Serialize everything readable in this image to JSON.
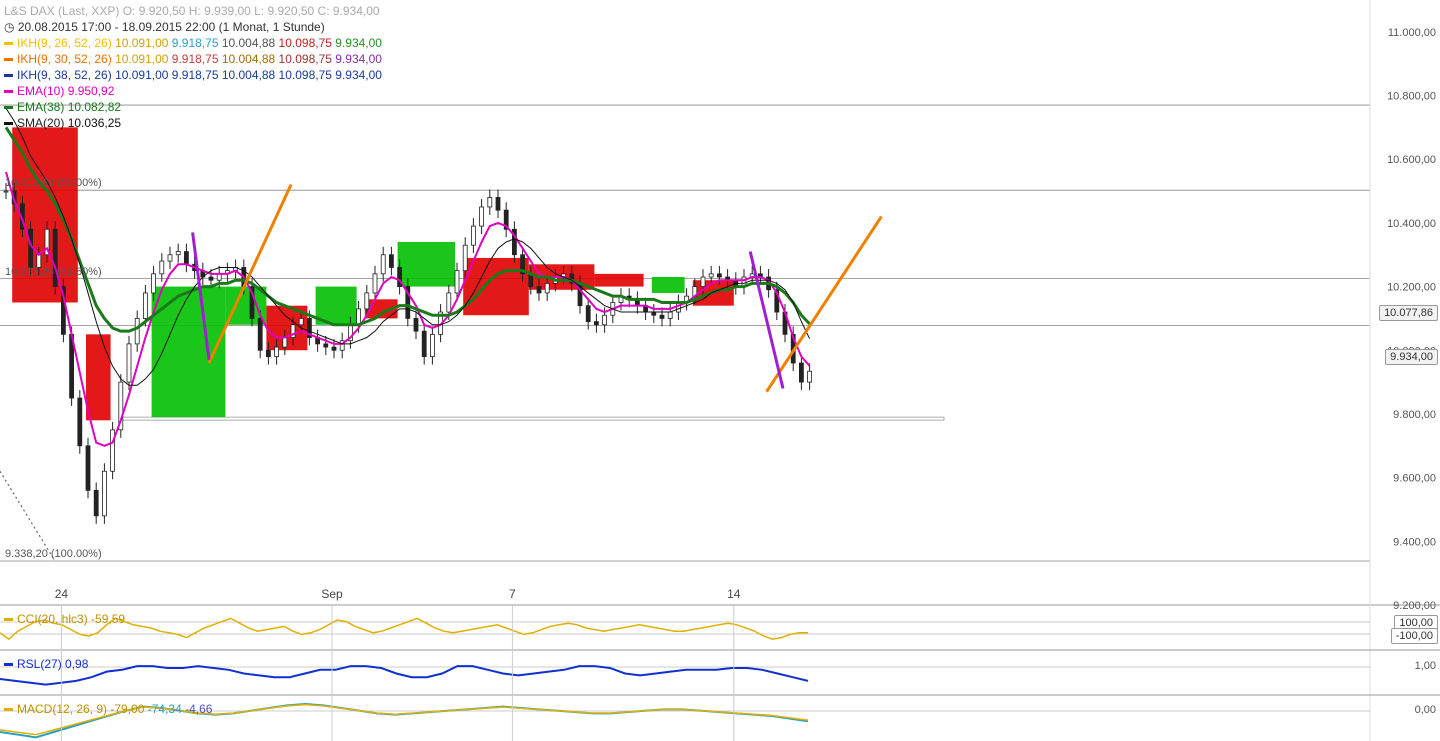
{
  "header": {
    "symbol_line": "L&S DAX (Last, XXP)  O: 9.920,50  H: 9.939,00  L: 9.920,50  C: 9.934,00",
    "range_line": "20.08.2015 17:00 - 18.09.2015 22:00 (1 Monat, 1 Stunde)"
  },
  "legend": [
    {
      "name": "IKH(9, 26, 52, 26)",
      "color": "#f0c000",
      "values": [
        {
          "v": "10.091,00",
          "c": "#d4a000"
        },
        {
          "v": "9.918,75",
          "c": "#2aa0c0"
        },
        {
          "v": "10.004,88",
          "c": "#555"
        },
        {
          "v": "10.098,75",
          "c": "#c02020"
        },
        {
          "v": "9.934,00",
          "c": "#2a8a2a"
        }
      ]
    },
    {
      "name": "IKH(9, 30, 52, 26)",
      "color": "#f07000",
      "values": [
        {
          "v": "10.091,00",
          "c": "#d4a000"
        },
        {
          "v": "9.918,75",
          "c": "#c04040"
        },
        {
          "v": "10.004,88",
          "c": "#a07000"
        },
        {
          "v": "10.098,75",
          "c": "#a03030"
        },
        {
          "v": "9.934,00",
          "c": "#8030a0"
        }
      ]
    },
    {
      "name": "IKH(9, 38, 52, 26)",
      "color": "#1a3a9a",
      "values": [
        {
          "v": "10.091,00",
          "c": "#1a3a9a"
        },
        {
          "v": "9.918,75",
          "c": "#1a3a9a"
        },
        {
          "v": "10.004,88",
          "c": "#1a3a9a"
        },
        {
          "v": "10.098,75",
          "c": "#1a3a9a"
        },
        {
          "v": "9.934,00",
          "c": "#1a3a9a"
        }
      ]
    },
    {
      "name": "EMA(10)",
      "color": "#e000c0",
      "values": [
        {
          "v": "9.950,92",
          "c": "#e000c0"
        }
      ]
    },
    {
      "name": "EMA(38)",
      "color": "#1a7a1a",
      "values": [
        {
          "v": "10.082,82",
          "c": "#1a7a1a"
        }
      ]
    },
    {
      "name": "SMA(20)",
      "color": "#111111",
      "values": [
        {
          "v": "10.036,25",
          "c": "#111"
        }
      ]
    }
  ],
  "indicators": {
    "cci": {
      "label": "CCI(20, hlc3)",
      "value": "-59,59",
      "color": "#e0b000",
      "levels": [
        "100,00",
        "-100,00"
      ]
    },
    "rsl": {
      "label": "RSL(27)",
      "value": "0,98",
      "color": "#1030d0",
      "level": "1,00"
    },
    "macd": {
      "label": "MACD(12, 26, 9)",
      "v1": "-79,00",
      "v2": "-74,34",
      "v3": "-4,66",
      "level": "0,00"
    }
  },
  "fib_labels": [
    {
      "text": "10.502,66 (50.00%)",
      "price": 10502.66
    },
    {
      "text": "10.225,35 (61.80%)",
      "price": 10225.35
    },
    {
      "text": "9.338,20 (100.00%)",
      "price": 9338.2
    }
  ],
  "price_boxes": {
    "last_close": "10.077,86",
    "current": "9.934,00"
  },
  "chart_data": {
    "type": "line",
    "title": "L&S DAX (Last, XXP)",
    "xlabel": "",
    "ylabel": "",
    "ylim": [
      9200,
      11100
    ],
    "y_ticks": [
      "11.000,00",
      "10.800,00",
      "10.600,00",
      "10.400,00",
      "10.200,00",
      "10.000,00",
      "9.800,00",
      "9.600,00",
      "9.400,00",
      "9.200,00"
    ],
    "y_tick_values": [
      11000,
      10800,
      10600,
      10400,
      10200,
      10000,
      9800,
      9600,
      9400,
      9200
    ],
    "x_ticks": [
      "24",
      "Sep",
      "7",
      "14"
    ],
    "x_tick_slots": [
      7,
      40,
      62,
      89
    ],
    "hlines": [
      10770,
      10502.66,
      10225.35,
      10077.86,
      9338.2
    ],
    "close": [
      10500,
      10460,
      10380,
      10260,
      10300,
      10380,
      10200,
      10050,
      9850,
      9700,
      9560,
      9480,
      9620,
      9750,
      9900,
      10020,
      10100,
      10180,
      10240,
      10280,
      10300,
      10310,
      10270,
      10250,
      10230,
      10220,
      10240,
      10250,
      10260,
      10200,
      10100,
      10000,
      9980,
      10010,
      10040,
      10080,
      10100,
      10040,
      10020,
      10010,
      10000,
      10030,
      10080,
      10130,
      10180,
      10240,
      10300,
      10260,
      10200,
      10100,
      10060,
      9980,
      10050,
      10120,
      10180,
      10250,
      10330,
      10390,
      10450,
      10480,
      10440,
      10380,
      10300,
      10240,
      10200,
      10180,
      10210,
      10230,
      10240,
      10210,
      10140,
      10090,
      10080,
      10110,
      10150,
      10170,
      10160,
      10140,
      10120,
      10110,
      10100,
      10120,
      10150,
      10170,
      10200,
      10230,
      10240,
      10230,
      10220,
      10200,
      10230,
      10240,
      10230,
      10190,
      10120,
      10050,
      9960,
      9900,
      9934
    ],
    "series": [
      {
        "name": "EMA(10)",
        "color": "#e000c0",
        "values": [
          10560,
          10470,
          10410,
          10330,
          10300,
          10320,
          10260,
          10170,
          10050,
          9930,
          9810,
          9710,
          9700,
          9710,
          9780,
          9860,
          9950,
          10040,
          10120,
          10190,
          10240,
          10270,
          10270,
          10260,
          10250,
          10240,
          10240,
          10240,
          10250,
          10230,
          10180,
          10110,
          10060,
          10040,
          10040,
          10050,
          10060,
          10050,
          10040,
          10030,
          10020,
          10020,
          10040,
          10070,
          10110,
          10160,
          10210,
          10230,
          10220,
          10180,
          10140,
          10080,
          10070,
          10080,
          10110,
          10160,
          10220,
          10280,
          10340,
          10390,
          10400,
          10390,
          10360,
          10320,
          10280,
          10240,
          10230,
          10230,
          10230,
          10220,
          10190,
          10160,
          10130,
          10120,
          10130,
          10140,
          10140,
          10140,
          10140,
          10130,
          10130,
          10130,
          10140,
          10150,
          10170,
          10190,
          10210,
          10220,
          10220,
          10220,
          10220,
          10230,
          10230,
          10220,
          10180,
          10120,
          10040,
          9980,
          9950.92
        ]
      },
      {
        "name": "EMA(38)",
        "color": "#1a7a1a",
        "values": [
          10700,
          10660,
          10620,
          10570,
          10530,
          10500,
          10460,
          10410,
          10350,
          10280,
          10210,
          10140,
          10100,
          10070,
          10060,
          10060,
          10070,
          10090,
          10110,
          10130,
          10150,
          10170,
          10180,
          10190,
          10200,
          10200,
          10210,
          10210,
          10220,
          10220,
          10210,
          10190,
          10170,
          10150,
          10140,
          10130,
          10120,
          10110,
          10100,
          10090,
          10080,
          10080,
          10080,
          10080,
          10090,
          10100,
          10120,
          10130,
          10140,
          10140,
          10130,
          10120,
          10110,
          10110,
          10110,
          10120,
          10140,
          10160,
          10190,
          10220,
          10240,
          10250,
          10250,
          10250,
          10240,
          10230,
          10230,
          10220,
          10220,
          10220,
          10210,
          10200,
          10190,
          10180,
          10170,
          10170,
          10160,
          10160,
          10160,
          10160,
          10150,
          10150,
          10150,
          10150,
          10160,
          10170,
          10180,
          10190,
          10190,
          10200,
          10200,
          10210,
          10210,
          10210,
          10200,
          10180,
          10150,
          10110,
          10082.82
        ]
      },
      {
        "name": "SMA(20)",
        "color": "#111111",
        "values": [
          10760,
          10720,
          10670,
          10610,
          10570,
          10530,
          10480,
          10420,
          10350,
          10270,
          10180,
          10090,
          10010,
          9950,
          9910,
          9890,
          9890,
          9910,
          9940,
          9990,
          10050,
          10110,
          10160,
          10200,
          10230,
          10250,
          10260,
          10260,
          10260,
          10250,
          10230,
          10200,
          10170,
          10140,
          10110,
          10090,
          10070,
          10060,
          10050,
          10040,
          10030,
          10020,
          10020,
          10030,
          10040,
          10060,
          10090,
          10110,
          10130,
          10130,
          10120,
          10100,
          10080,
          10080,
          10090,
          10110,
          10140,
          10180,
          10230,
          10280,
          10320,
          10340,
          10350,
          10340,
          10320,
          10290,
          10260,
          10240,
          10230,
          10220,
          10200,
          10180,
          10160,
          10140,
          10130,
          10120,
          10120,
          10120,
          10120,
          10120,
          10120,
          10120,
          10130,
          10140,
          10150,
          10160,
          10180,
          10190,
          10200,
          10210,
          10210,
          10220,
          10220,
          10220,
          10210,
          10190,
          10150,
          10090,
          10036.25
        ]
      }
    ],
    "cloud": [
      {
        "from": 10,
        "to": 13,
        "top": 10050,
        "bottom": 9780,
        "color": "#e00000"
      },
      {
        "from": 1,
        "to": 9,
        "top": 10700,
        "bottom": 10150,
        "color": "#e00000"
      },
      {
        "from": 18,
        "to": 27,
        "top": 10200,
        "bottom": 9790,
        "color": "#00c000"
      },
      {
        "from": 27,
        "to": 32,
        "top": 10200,
        "bottom": 10080,
        "color": "#00c000"
      },
      {
        "from": 32,
        "to": 37,
        "top": 10140,
        "bottom": 10000,
        "color": "#e00000"
      },
      {
        "from": 38,
        "to": 43,
        "top": 10200,
        "bottom": 10080,
        "color": "#00c000"
      },
      {
        "from": 44,
        "to": 48,
        "top": 10160,
        "bottom": 10100,
        "color": "#e00000"
      },
      {
        "from": 48,
        "to": 55,
        "top": 10340,
        "bottom": 10200,
        "color": "#00c000"
      },
      {
        "from": 56,
        "to": 64,
        "top": 10290,
        "bottom": 10110,
        "color": "#e00000"
      },
      {
        "from": 64,
        "to": 72,
        "top": 10270,
        "bottom": 10190,
        "color": "#e00000"
      },
      {
        "from": 72,
        "to": 78,
        "top": 10240,
        "bottom": 10200,
        "color": "#e00000"
      },
      {
        "from": 79,
        "to": 83,
        "top": 10230,
        "bottom": 10180,
        "color": "#00c000"
      },
      {
        "from": 84,
        "to": 89,
        "top": 10220,
        "bottom": 10140,
        "color": "#e00000"
      }
    ],
    "trendlines": [
      {
        "x1": 25,
        "y1": 9960,
        "x2": 35,
        "y2": 10520,
        "color": "#f08000"
      },
      {
        "x1": 93,
        "y1": 9870,
        "x2": 107,
        "y2": 10420,
        "color": "#f08000"
      },
      {
        "x1": 23,
        "y1": 10370,
        "x2": 25,
        "y2": 9970,
        "color": "#a020d0"
      },
      {
        "x1": 91,
        "y1": 10310,
        "x2": 95,
        "y2": 9880,
        "color": "#a020d0"
      }
    ],
    "cci_values": [
      -60,
      -140,
      -40,
      20,
      80,
      100,
      60,
      40,
      -20,
      -80,
      -100,
      -60,
      40,
      120,
      80,
      40,
      20,
      0,
      -40,
      -60,
      -80,
      -120,
      -60,
      0,
      40,
      80,
      120,
      60,
      0,
      -40,
      -20,
      0,
      20,
      -40,
      -80,
      -60,
      -20,
      40,
      100,
      80,
      20,
      -20,
      -60,
      -40,
      0,
      40,
      80,
      120,
      60,
      0,
      -40,
      -60,
      -40,
      -20,
      0,
      20,
      40,
      0,
      -40,
      -80,
      -60,
      -20,
      20,
      40,
      60,
      40,
      0,
      -20,
      -40,
      -20,
      0,
      20,
      40,
      20,
      0,
      -20,
      -40,
      -40,
      -20,
      0,
      20,
      40,
      60,
      40,
      0,
      -40,
      -100,
      -140,
      -120,
      -80,
      -60,
      -59.59
    ],
    "rsl_values": [
      0.985,
      0.98,
      0.975,
      0.97,
      0.975,
      0.98,
      0.99,
      1.005,
      1.01,
      1.02,
      1.02,
      1.015,
      1.015,
      1.02,
      1.015,
      1.01,
      1.0,
      0.995,
      0.99,
      0.99,
      1.0,
      1.01,
      1.01,
      1.02,
      1.02,
      1.015,
      1.0,
      0.99,
      0.99,
      1.0,
      1.02,
      1.02,
      1.01,
      1.0,
      0.995,
      1.0,
      1.005,
      1.01,
      1.02,
      1.02,
      1.015,
      1.0,
      0.995,
      1.0,
      1.005,
      1.01,
      1.01,
      1.01,
      1.015,
      1.015,
      1.01,
      1.0,
      0.99,
      0.98
    ],
    "macd_values": [
      -160,
      -180,
      -200,
      -160,
      -120,
      -80,
      -40,
      0,
      30,
      20,
      0,
      -20,
      -30,
      -20,
      0,
      20,
      40,
      50,
      40,
      20,
      0,
      -20,
      -30,
      -20,
      -10,
      0,
      10,
      20,
      30,
      20,
      10,
      0,
      -10,
      -20,
      -20,
      -10,
      0,
      10,
      10,
      0,
      -10,
      -20,
      -30,
      -40,
      -60,
      -79
    ]
  }
}
